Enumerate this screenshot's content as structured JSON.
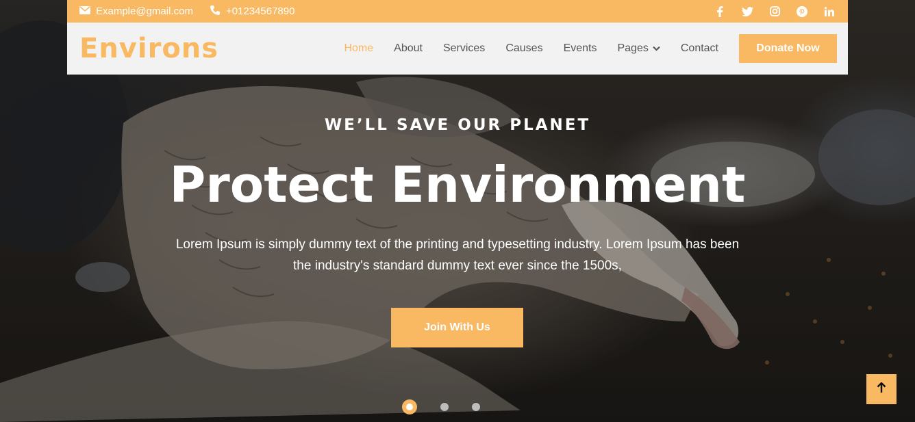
{
  "topbar": {
    "email": "Example@gmail.com",
    "phone": "+01234567890",
    "social_icons": [
      "facebook-icon",
      "twitter-icon",
      "instagram-icon",
      "pinterest-icon",
      "linkedin-icon"
    ]
  },
  "navbar": {
    "logo": "Environs",
    "links": [
      {
        "label": "Home",
        "active": true
      },
      {
        "label": "About",
        "active": false
      },
      {
        "label": "Services",
        "active": false
      },
      {
        "label": "Causes",
        "active": false
      },
      {
        "label": "Events",
        "active": false
      },
      {
        "label": "Pages",
        "active": false
      },
      {
        "label": "Contact",
        "active": false
      }
    ],
    "donate_label": "Donate Now"
  },
  "hero": {
    "kicker": "WE’LL SAVE OUR PLANET",
    "headline": "Protect Environment",
    "lead": "Lorem Ipsum is simply dummy text of the printing and typesetting industry. Lorem Ipsum has been the industry's standard dummy text ever since the 1500s,",
    "cta_label": "Join With Us",
    "slide_count": 3,
    "active_slide": 1
  },
  "colors": {
    "accent": "#f9b862",
    "nav_bg": "#f2f2f3",
    "nav_text": "#555555"
  }
}
